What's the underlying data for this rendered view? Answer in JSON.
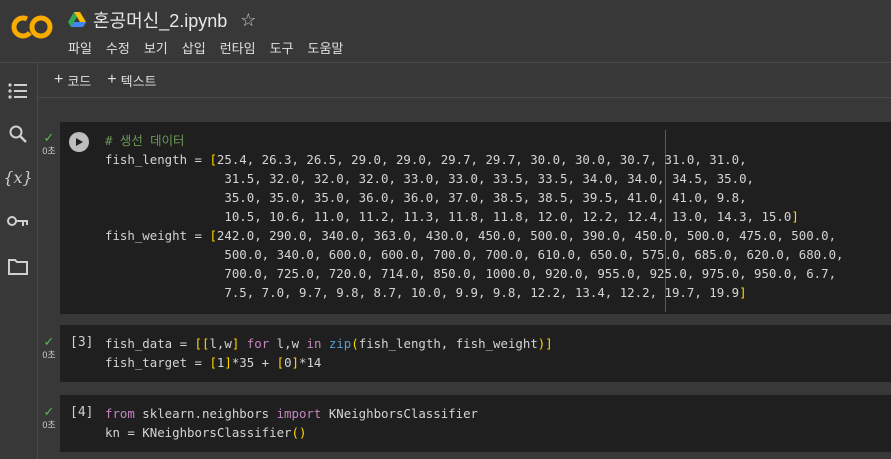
{
  "header": {
    "title": "혼공머신_2.ipynb",
    "menu": [
      "파일",
      "수정",
      "보기",
      "삽입",
      "런타임",
      "도구",
      "도움말"
    ]
  },
  "rail": {
    "icons": [
      "toc-icon",
      "search-icon",
      "variables-icon",
      "key-icon",
      "folder-icon"
    ],
    "variables_text": "{x}"
  },
  "toolbar": {
    "add_code": "코드",
    "add_text": "텍스트"
  },
  "cells": [
    {
      "exec_label": "",
      "status": "0초",
      "lines": [
        "# 생선 데이터",
        "fish_length = [25.4, 26.3, 26.5, 29.0, 29.0, 29.7, 29.7, 30.0, 30.0, 30.7, 31.0, 31.0,",
        "                31.5, 32.0, 32.0, 32.0, 33.0, 33.0, 33.5, 33.5, 34.0, 34.0, 34.5, 35.0,",
        "                35.0, 35.0, 35.0, 36.0, 36.0, 37.0, 38.5, 38.5, 39.5, 41.0, 41.0, 9.8,",
        "                10.5, 10.6, 11.0, 11.2, 11.3, 11.8, 11.8, 12.0, 12.2, 12.4, 13.0, 14.3, 15.0]",
        "fish_weight = [242.0, 290.0, 340.0, 363.0, 430.0, 450.0, 500.0, 390.0, 450.0, 500.0, 475.0, 500.0,",
        "                500.0, 340.0, 600.0, 600.0, 700.0, 700.0, 610.0, 650.0, 575.0, 685.0, 620.0, 680.0,",
        "                700.0, 725.0, 720.0, 714.0, 850.0, 1000.0, 920.0, 955.0, 925.0, 975.0, 950.0, 6.7,",
        "                7.5, 7.0, 9.7, 9.8, 8.7, 10.0, 9.9, 9.8, 12.2, 13.4, 12.2, 19.7, 19.9]"
      ]
    },
    {
      "exec_label": "[3]",
      "status": "0초",
      "lines": [
        "fish_data = [[l,w] for l,w in zip(fish_length, fish_weight)]",
        "fish_target = [1]*35 + [0]*14"
      ]
    },
    {
      "exec_label": "[4]",
      "status": "0초",
      "lines": [
        "from sklearn.neighbors import KNeighborsClassifier",
        "kn = KNeighborsClassifier()"
      ]
    }
  ],
  "colors": {
    "background": "#383838",
    "cell_bg": "#1f1f1f",
    "bracket": "#ffd700",
    "keyword": "#c586c0",
    "builtin": "#569cd6",
    "comment": "#6a9955",
    "logo_orange": "#f9ab00"
  }
}
